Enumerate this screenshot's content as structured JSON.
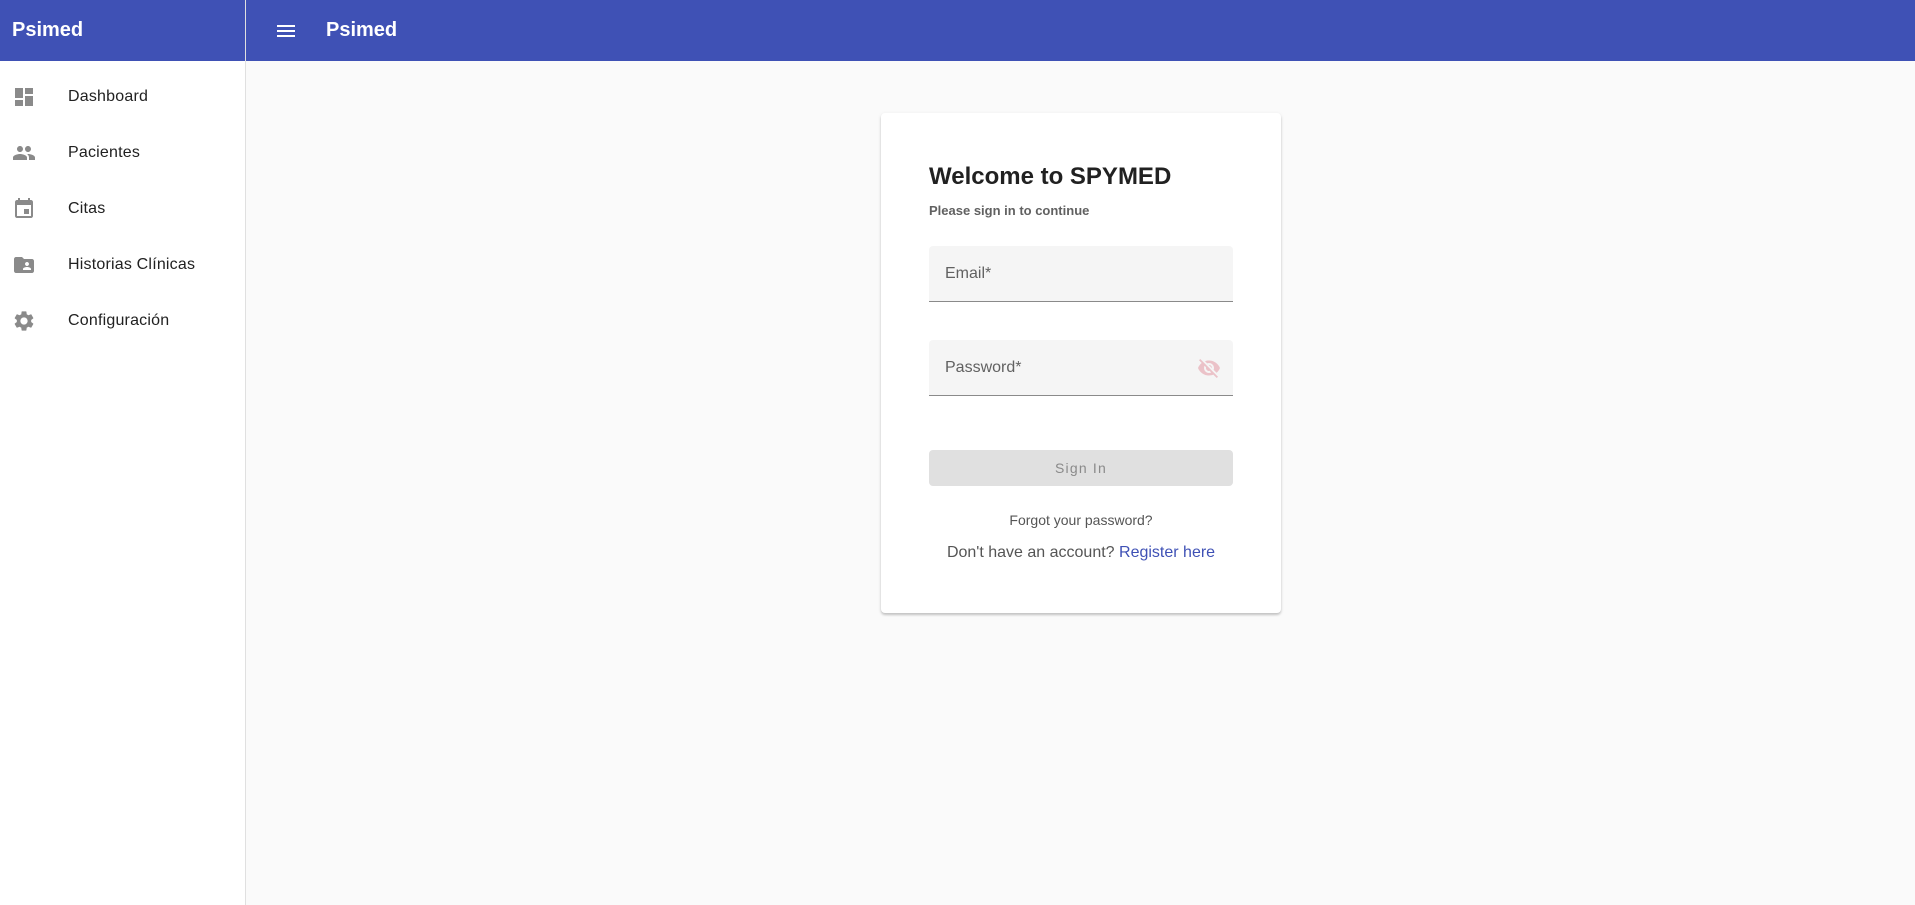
{
  "sidebar": {
    "brand": "Psimed",
    "items": [
      {
        "label": "Dashboard",
        "icon": "dashboard-icon"
      },
      {
        "label": "Pacientes",
        "icon": "people-icon"
      },
      {
        "label": "Citas",
        "icon": "calendar-icon"
      },
      {
        "label": "Historias Clínicas",
        "icon": "folder-shared-icon"
      },
      {
        "label": "Configuración",
        "icon": "settings-icon"
      }
    ]
  },
  "topbar": {
    "menu_icon": "menu-icon",
    "title": "Psimed"
  },
  "login": {
    "title": "Welcome to SPYMED",
    "subtitle": "Please sign in to continue",
    "email_placeholder": "Email*",
    "email_value": "",
    "password_placeholder": "Password*",
    "password_value": "",
    "visibility_icon": "visibility-off-icon",
    "signin_label": "Sign In",
    "forgot_label": "Forgot your password?",
    "register_prompt": "Don't have an account?",
    "register_link": "Register here"
  },
  "colors": {
    "primary": "#3f51b5",
    "background": "#fafafa",
    "disabled_button": "#e0e0e0"
  }
}
